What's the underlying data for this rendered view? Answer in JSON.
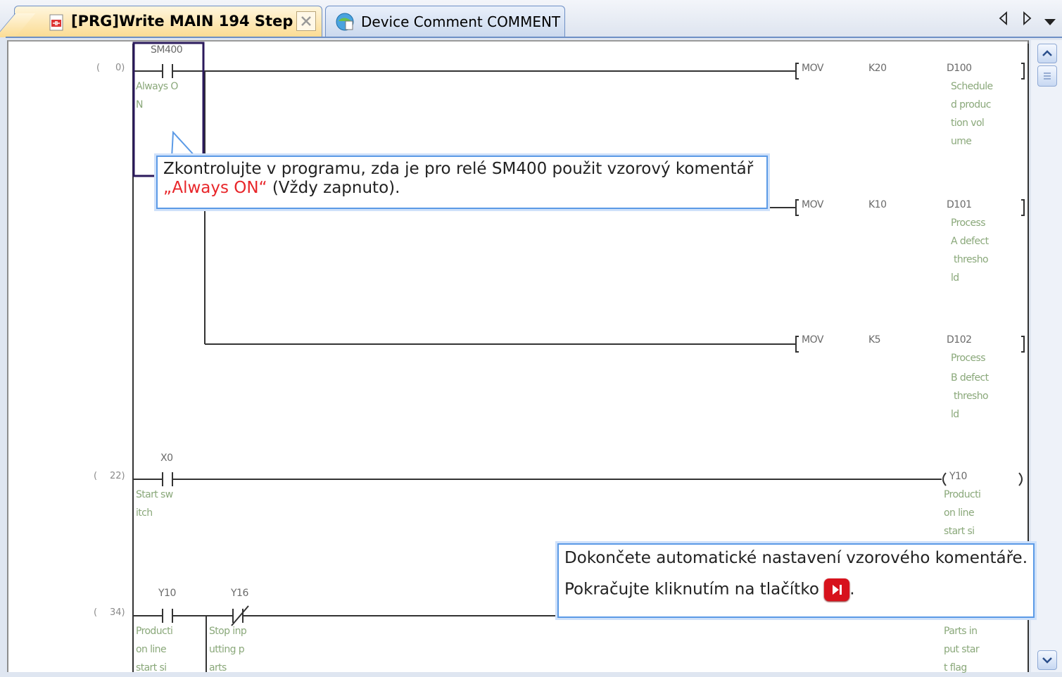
{
  "tabs": [
    {
      "label": "[PRG]Write MAIN 194 Step",
      "active": true
    },
    {
      "label": "Device Comment COMMENT",
      "active": false
    }
  ],
  "ladder": {
    "steps": [
      "0)",
      "22)",
      "34)"
    ],
    "contacts": {
      "sm400": {
        "device": "SM400",
        "comment1": "Always O",
        "comment2": "N"
      },
      "x0": {
        "device": "X0",
        "comment1": "Start sw",
        "comment2": "itch"
      },
      "y10": {
        "device": "Y10",
        "comment1": "Producti",
        "comment2": "on line",
        "comment3": "start si"
      },
      "y16": {
        "device": "Y16",
        "comment1": "Stop inp",
        "comment2": "utting p",
        "comment3": "arts"
      }
    },
    "instructions": [
      {
        "op": "MOV",
        "src": "K20",
        "dst": "D100",
        "comment": [
          "Schedule",
          "d produc",
          "tion vol",
          "ume"
        ]
      },
      {
        "op": "MOV",
        "src": "K10",
        "dst": "D101",
        "comment": [
          "Process",
          "A defect",
          "thresho",
          "ld"
        ]
      },
      {
        "op": "MOV",
        "src": "K5",
        "dst": "D102",
        "comment": [
          "Process",
          "B defect",
          "thresho",
          "ld"
        ]
      }
    ],
    "coils": {
      "y10": {
        "device": "Y10",
        "comment": [
          "Producti",
          "on line",
          "start si"
        ]
      },
      "coil34": {
        "comment": [
          "Parts in",
          "put star",
          "t flag"
        ]
      }
    }
  },
  "callout1": {
    "line1": "Zkontrolujte v programu, zda je pro relé SM400 použit vzorový komentář",
    "highlight": "„Always ON“",
    "line2_rest": " (Vždy zapnuto)."
  },
  "callout2": {
    "line1": "Dokončete automatické nastavení vzorového komentáře.",
    "line2": "Pokračujte kliknutím na tlačítko",
    "line2_end": "."
  },
  "colors": {
    "accent": "#5b9ae6",
    "highlight": "#e8262a",
    "comment": "#8aa87a",
    "next_button": "#d7121c"
  }
}
